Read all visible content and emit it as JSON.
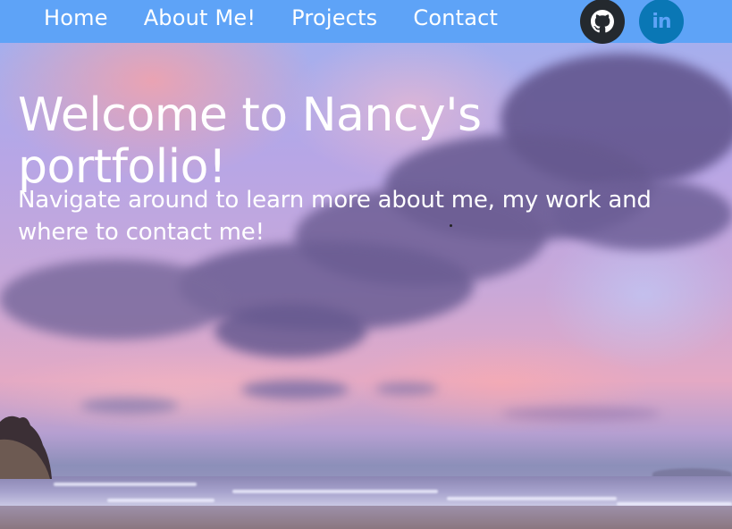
{
  "nav": {
    "links": [
      {
        "label": "Home"
      },
      {
        "label": "About Me!"
      },
      {
        "label": "Projects"
      },
      {
        "label": "Contact"
      }
    ],
    "social": {
      "github_icon": "github-icon",
      "linkedin_icon": "linkedin-icon",
      "linkedin_text": "in"
    }
  },
  "hero": {
    "title": "Welcome to Nancy's portfolio!",
    "subtitle": "Navigate around to learn more about me, my work and where to contact me!"
  },
  "colors": {
    "navbar": "#5ea3f7",
    "github_bg": "#24292e",
    "linkedin_bg": "#0a77b5",
    "text": "#ffffff"
  }
}
